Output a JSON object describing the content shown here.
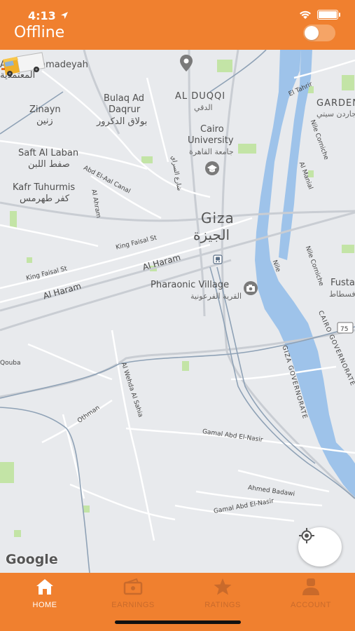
{
  "status_bar": {
    "time": "4:13"
  },
  "header": {
    "title": "Offline",
    "online_toggle": "off"
  },
  "map": {
    "labels": {
      "almutamadeyah": "Al Mohatamadeyah",
      "almutamadeyah_ar": "المعتمدية",
      "bulaq": "Bulaq Ad",
      "bulaq2": "Daqrur",
      "bulaq_ar": "بولاق الدكرور",
      "zinayn": "Zinayn",
      "zinayn_ar": "زنين",
      "saft": "Saft Al Laban",
      "saft_ar": "صفط اللبن",
      "kafr": "Kafr Tuhurmis",
      "kafr_ar": "كفر طهرمس",
      "duqqi": "AL DUQQI",
      "duqqi_ar": "الدقي",
      "cairo_uni": "Cairo",
      "cairo_uni2": "University",
      "cairo_uni_ar": "جامعة القاهرة",
      "garden": "GARDEN C",
      "garden_ar": "جاردن سيتي",
      "giza": "Giza",
      "giza_ar": "الجيزة",
      "pharaonic": "Pharaonic Village",
      "pharaonic_ar": "القرية الفرعونية",
      "fusta": "Fusta",
      "fusta_ar": "فسطاط",
      "route_75": "75",
      "giza_gov": "GIZA GOVERNORATE",
      "cairo_gov": "CAIRO GOVERNORATE",
      "nile": "Nile",
      "nile_corniche": "Nile Corniche",
      "nile_corniche2": "Nile Corniche",
      "el_tahrir": "El Tahrir",
      "abd_el_aal": "Abd El-Aal Canal",
      "al_ahram_st": "Al Ahram",
      "king_faisal": "King Faisal St",
      "king_faisal2": "King Faisal St",
      "al_haram": "Al Haram",
      "al_haram2": "Al Haram",
      "al_wahda": "Al Wehda Al Sahia",
      "othman": "Othman",
      "gamal1": "Gamal Abd El-Nasir",
      "gamal2": "Gamal Abd El-Nasir",
      "ahmed_badawi": "Ahmed Badawi",
      "al_manial": "Al Manial",
      "al_saraya": "شارع السراي",
      "qouba": "Qouba",
      "google": "Google"
    }
  },
  "tabs": [
    {
      "label": "HOME",
      "icon": "home-icon"
    },
    {
      "label": "EARNINGS",
      "icon": "wallet-icon"
    },
    {
      "label": "RATINGS",
      "icon": "star-icon"
    },
    {
      "label": "ACCOUNT",
      "icon": "person-icon"
    }
  ],
  "colors": {
    "brand": "#f0802f",
    "water": "#9ec3ea",
    "park": "#b9e09a"
  }
}
